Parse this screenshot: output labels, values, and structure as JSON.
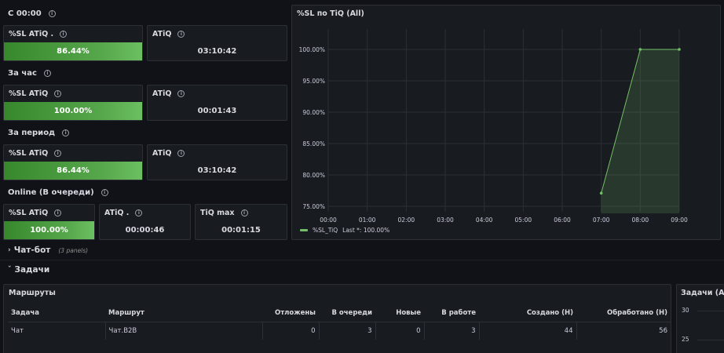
{
  "rows": [
    {
      "title": "С 00:00"
    },
    {
      "title": "За час"
    },
    {
      "title": "За период"
    },
    {
      "title": "Online (В очереди)"
    }
  ],
  "stats": {
    "r1": {
      "sl_title": "%SL ATiQ .",
      "sl_value": "86.44%",
      "atiq_title": "ATiQ",
      "atiq_value": "03:10:42"
    },
    "r2": {
      "sl_title": "%SL ATiQ",
      "sl_value": "100.00%",
      "atiq_title": "ATiQ",
      "atiq_value": "00:01:43"
    },
    "r3": {
      "sl_title": "%SL ATiQ",
      "sl_value": "86.44%",
      "atiq_title": "ATiQ",
      "atiq_value": "03:10:42"
    },
    "r4": {
      "sl_title": "%SL ATiQ",
      "sl_value": "100.00%",
      "atiq_title": "ATiQ .",
      "atiq_value": "00:00:46",
      "tiq_title": "TiQ max",
      "tiq_value": "00:01:15"
    }
  },
  "chart": {
    "panel_title": "%SL по TiQ (All)",
    "legend_label": "%SL_TiQ",
    "legend_last": "Last *: 100.00%",
    "series_color": "#73bf69"
  },
  "chart_data": {
    "type": "area",
    "title": "%SL по TiQ (All)",
    "x_ticks": [
      "00:00",
      "01:00",
      "02:00",
      "03:00",
      "04:00",
      "05:00",
      "06:00",
      "07:00",
      "08:00",
      "09:00"
    ],
    "y_ticks": [
      "75.00%",
      "80.00%",
      "85.00%",
      "90.00%",
      "95.00%",
      "100.00%"
    ],
    "xlim": [
      0,
      9
    ],
    "ylim": [
      75,
      100
    ],
    "series": [
      {
        "name": "%SL_TiQ",
        "x": [
          7,
          8,
          9
        ],
        "y": [
          77.1,
          100,
          100
        ]
      }
    ],
    "grid": true,
    "legend_placement": "bottom-left"
  },
  "sections": {
    "chatbot": {
      "label": "Чат-бот",
      "note": "(3 panels)"
    },
    "tasks": {
      "label": "Задачи"
    }
  },
  "routes": {
    "title": "Маршруты",
    "columns": [
      "Задача",
      "Маршрут",
      "Отложены",
      "В очереди",
      "Новые",
      "В работе",
      "Создано (Н)",
      "Обработано (Н)"
    ],
    "rows": [
      [
        "Чат",
        "Чат.B2B",
        "0",
        "3",
        "0",
        "3",
        "44",
        "56"
      ]
    ]
  },
  "tasks_panel": {
    "title": "Задачи (All)",
    "y_ticks": [
      "30",
      "25"
    ]
  }
}
